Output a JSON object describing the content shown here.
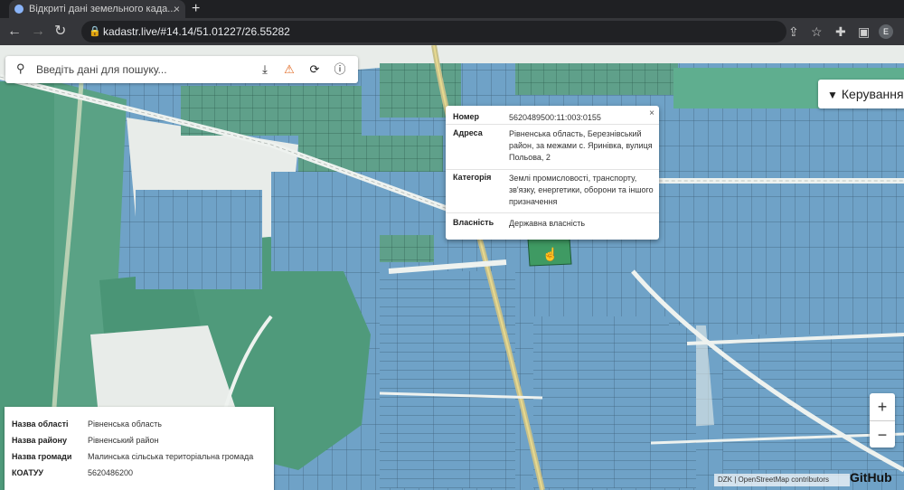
{
  "browser": {
    "tab_title": "Відкриті дані земельного када...",
    "tab_close": "×",
    "new_tab": "+",
    "url": "kadastr.live/#14.14/51.01227/26.55282"
  },
  "search": {
    "placeholder": "Введіть дані для пошуку..."
  },
  "manage_button": {
    "label": "Керування"
  },
  "popup": {
    "close": "×",
    "rows": [
      {
        "label": "Номер",
        "value": "5620489500:11:003:0155"
      },
      {
        "label": "Адреса",
        "value": "Рівненська область, Березнівський район, за межами с. Яринівка, вулиця Польова, 2"
      },
      {
        "label": "Категорія",
        "value": "Землі промисловості, транспорту, зв'язку, енергетики, оборони та іншого призначення"
      },
      {
        "label": "Власність",
        "value": "Державна власність"
      }
    ]
  },
  "zoom": {
    "in": "+",
    "out": "−"
  },
  "attribution": "DZK | OpenStreetMap contributors",
  "github": "GitHub",
  "region_panel": {
    "rows": [
      {
        "label": "Назва області",
        "value": "Рівненська область"
      },
      {
        "label": "Назва району",
        "value": "Рівненський район"
      },
      {
        "label": "Назва громади",
        "value": "Малинська сільська територіальна громада"
      },
      {
        "label": "КОАТУУ",
        "value": "5620486200"
      }
    ]
  },
  "colors": {
    "parcel_blue": "#6fa2c7",
    "forest_green": "#4f9a7b",
    "free_land": "#e8ece9",
    "road": "#c7c08a",
    "highlight": "#3f9a63"
  },
  "icons": [
    "search-icon",
    "download-icon",
    "warning-icon",
    "refresh-icon",
    "info-icon",
    "filter-icon",
    "close-icon"
  ]
}
